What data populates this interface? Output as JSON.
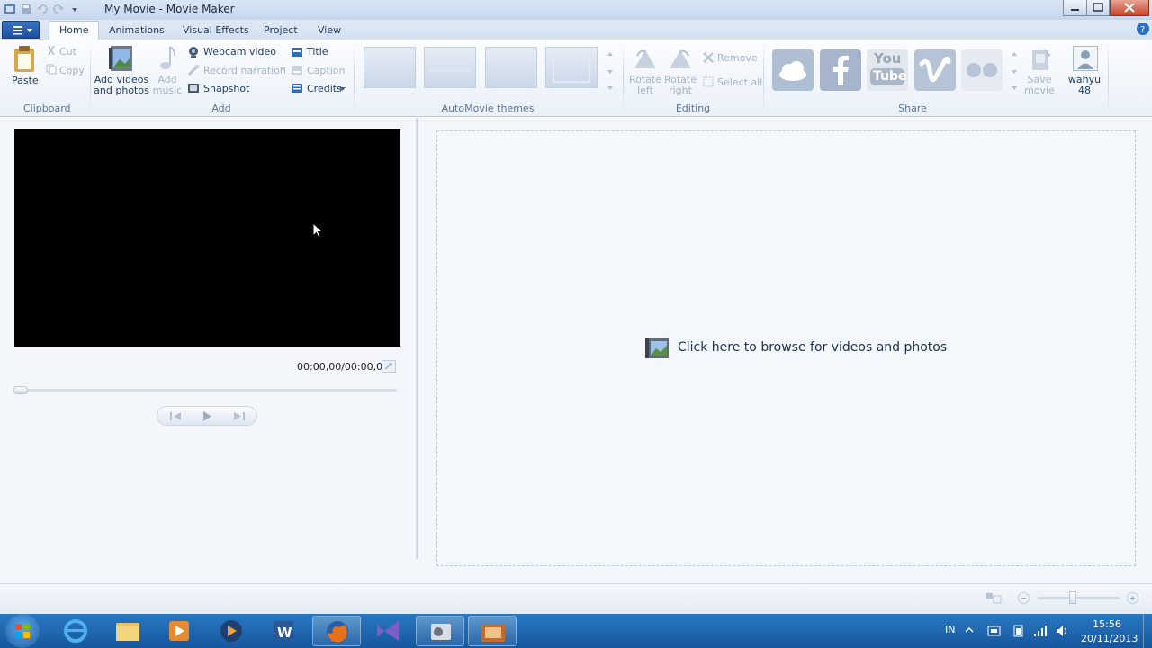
{
  "window": {
    "title": "My Movie - Movie Maker"
  },
  "tabs": [
    {
      "label": "Home",
      "active": true
    },
    {
      "label": "Animations"
    },
    {
      "label": "Visual Effects"
    },
    {
      "label": "Project"
    },
    {
      "label": "View"
    }
  ],
  "ribbon": {
    "clipboard": {
      "paste": "Paste",
      "cut": "Cut",
      "copy": "Copy",
      "group": "Clipboard"
    },
    "add": {
      "add_videos_line1": "Add videos",
      "add_videos_line2": "and photos",
      "add_music_line1": "Add",
      "add_music_line2": "music",
      "webcam": "Webcam video",
      "narration": "Record narration",
      "snapshot": "Snapshot",
      "title": "Title",
      "caption": "Caption",
      "credits": "Credits",
      "group": "Add"
    },
    "themes": {
      "group": "AutoMovie themes"
    },
    "editing": {
      "rotate_left_line1": "Rotate",
      "rotate_left_line2": "left",
      "rotate_right_line1": "Rotate",
      "rotate_right_line2": "right",
      "remove": "Remove",
      "select_all": "Select all",
      "group": "Editing"
    },
    "share": {
      "save_line1": "Save",
      "save_line2": "movie",
      "user_line1": "wahyu",
      "user_line2": "48",
      "group": "Share",
      "youtube_line1": "You",
      "youtube_line2": "Tube"
    }
  },
  "preview": {
    "time": "00:00,00/00:00,00"
  },
  "storyboard": {
    "prompt": "Click here to browse for videos and photos"
  },
  "taskbar": {
    "lang": "IN",
    "time": "15:56",
    "date": "20/11/2013"
  },
  "colors": {
    "accent": "#1c4f9e",
    "taskbar": "#1f68b0",
    "preview_bg": "#000000"
  }
}
